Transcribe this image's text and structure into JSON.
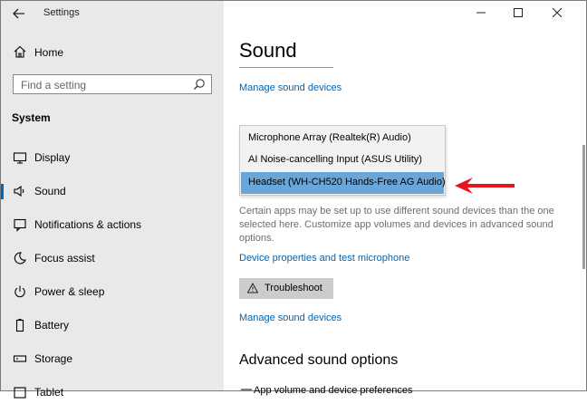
{
  "window": {
    "title": "Settings"
  },
  "sidebar": {
    "home_label": "Home",
    "search_placeholder": "Find a setting",
    "section_label": "System",
    "items": [
      {
        "label": "Display",
        "icon": "display-icon"
      },
      {
        "label": "Sound",
        "icon": "speaker-icon",
        "active": true
      },
      {
        "label": "Notifications & actions",
        "icon": "notification-icon"
      },
      {
        "label": "Focus assist",
        "icon": "moon-icon"
      },
      {
        "label": "Power & sleep",
        "icon": "power-icon"
      },
      {
        "label": "Battery",
        "icon": "battery-icon"
      },
      {
        "label": "Storage",
        "icon": "storage-icon"
      },
      {
        "label": "Tablet",
        "icon": "tablet-icon"
      }
    ]
  },
  "main": {
    "title": "Sound",
    "manage_devices_link": "Manage sound devices",
    "dropdown_options": [
      "Microphone Array (Realtek(R) Audio)",
      "AI Noise-cancelling Input (ASUS Utility)",
      "Headset (WH-CH520 Hands-Free AG Audio)"
    ],
    "dropdown_selected_index": 2,
    "description": "Certain apps may be set up to use different sound devices than the one selected here. Customize app volumes and devices in advanced sound options.",
    "device_properties_link": "Device properties and test microphone",
    "troubleshoot_label": "Troubleshoot",
    "manage_devices_link_2": "Manage sound devices",
    "advanced_heading": "Advanced sound options",
    "app_volume_partial": "App volume and device preferences"
  },
  "colors": {
    "accent": "#0067c0",
    "link": "#0063b1",
    "selection": "#6aa7d8",
    "annotation_arrow": "#e8141c"
  }
}
